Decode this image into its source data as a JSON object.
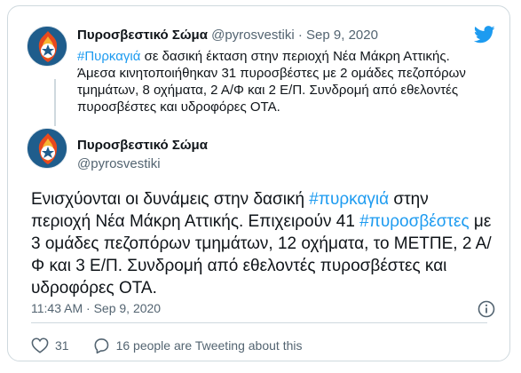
{
  "parent_tweet": {
    "display_name": "Πυροσβεστικό Σώμα",
    "handle": "@pyrosvestiki",
    "separator": "·",
    "date": "Sep 9, 2020",
    "hashtag": "#Πυρκαγιά",
    "text_line1_rest": " σε δασική έκταση στην περιοχή Νέα Μάκρη Αττικής.",
    "text_line2": "Άμεσα κινητοποιήθηκαν 31 πυροσβέστες με 2 ομάδες πεζοπόρων",
    "text_line3": "τμημάτων, 8 οχήματα, 2 Α/Φ και 2  Ε/Π. Συνδρομή από εθελοντές",
    "text_line4": "πυροσβέστες  και υδροφόρες ΟΤΑ."
  },
  "main_tweet": {
    "display_name": "Πυροσβεστικό Σώμα",
    "handle": "@pyrosvestiki",
    "text_part1": "Ενισχύονται οι δυνάμεις στην δασική ",
    "hashtag1": "#πυρκαγιά",
    "text_part2": " στην περιοχή Νέα Μάκρη Αττικής. Επιχειρούν 41 ",
    "hashtag2": "#πυροσβέστες",
    "text_part3": " με 3 ομάδες πεζοπόρων  τμημάτων, 12 οχήματα, το ΜΕΤΠΕ, 2 Α/Φ και 3 Ε/Π. Συνδρομή από εθελοντές πυροσβέστες και υδροφόρες ΟΤΑ.",
    "time": "11:43 AM",
    "separator": "·",
    "date": "Sep 9, 2020",
    "likes": "31",
    "replies_text": "16 people are Tweeting about this"
  },
  "icons": {
    "logo": "twitter-bird-icon",
    "info": "info-icon",
    "like": "heart-icon",
    "reply": "speech-bubble-icon"
  },
  "colors": {
    "link": "#1d9bf0",
    "muted": "#536471",
    "avatar_bg": "#1f5d8c"
  }
}
